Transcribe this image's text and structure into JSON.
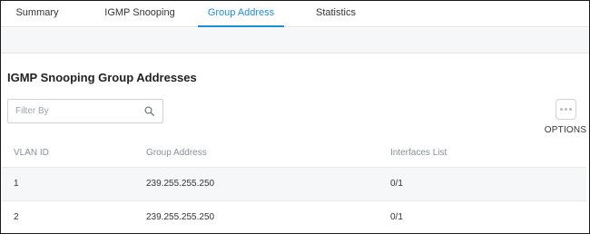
{
  "tabs": [
    {
      "label": "Summary"
    },
    {
      "label": "IGMP Snooping"
    },
    {
      "label": "Group Address"
    },
    {
      "label": "Statistics"
    }
  ],
  "active_tab": "Group Address",
  "accent_color": "#1a8fd9",
  "section": {
    "title": "IGMP Snooping Group Addresses"
  },
  "filter": {
    "placeholder": "Filter By",
    "value": "",
    "icon": "search-icon"
  },
  "options": {
    "label": "OPTIONS",
    "icon": "more-dots-icon"
  },
  "table": {
    "columns": [
      "VLAN ID",
      "Group Address",
      "Interfaces List"
    ],
    "rows": [
      {
        "vlan_id": "1",
        "group_address": "239.255.255.250",
        "interfaces": "0/1"
      },
      {
        "vlan_id": "2",
        "group_address": "239.255.255.250",
        "interfaces": "0/1"
      }
    ]
  }
}
